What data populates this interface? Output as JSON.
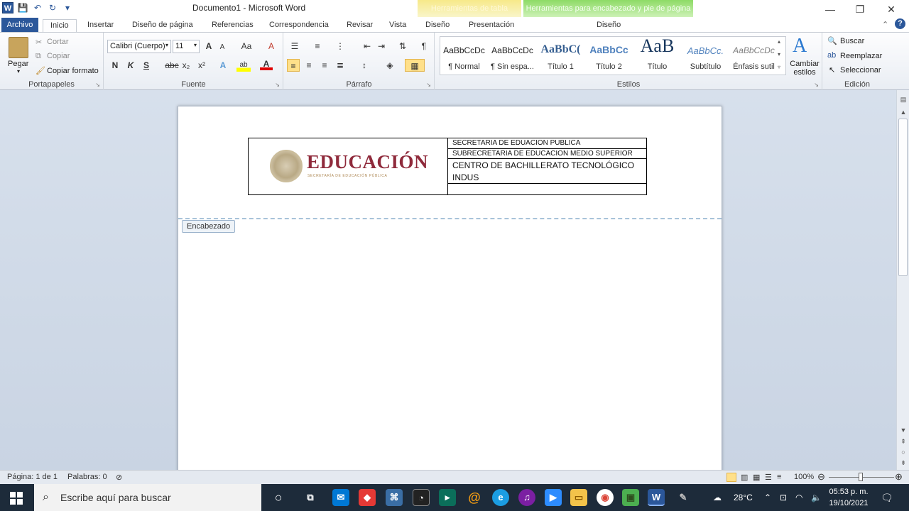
{
  "window": {
    "title": "Documento1  -  Microsoft Word",
    "minimize_glyph": "—",
    "restore_glyph": "❐",
    "close_glyph": "✕"
  },
  "qat": {
    "app_icon": "W",
    "save_glyph": "💾",
    "undo_glyph": "↶",
    "redo_glyph": "↻",
    "customize_glyph": "▾"
  },
  "context_tabs": {
    "table_tools": "Herramientas de tabla",
    "header_footer_tools": "Herramientas para encabezado y pie de página"
  },
  "tabs": {
    "file": "Archivo",
    "home": "Inicio",
    "insert": "Insertar",
    "page_layout": "Diseño de página",
    "references": "Referencias",
    "mailings": "Correspondencia",
    "review": "Revisar",
    "view": "Vista",
    "table_design": "Diseño",
    "table_layout": "Presentación",
    "header_design": "Diseño"
  },
  "clipboard": {
    "label": "Portapapeles",
    "paste": "Pegar",
    "cut": "Cortar",
    "copy": "Copiar",
    "format_painter": "Copiar formato"
  },
  "font": {
    "label": "Fuente",
    "name": "Calibri (Cuerpo)",
    "size": "11",
    "bold": "N",
    "italic": "K",
    "underline": "S",
    "strike": "abc",
    "subscript": "x₂",
    "superscript": "x²",
    "grow": "A",
    "shrink": "A",
    "case": "Aa",
    "clear": "A",
    "effects": "A",
    "highlight": "ab",
    "color": "A"
  },
  "paragraph": {
    "label": "Párrafo",
    "pilcrow": "¶"
  },
  "styles": {
    "label": "Estilos",
    "items": [
      {
        "sample": "AaBbCcDc",
        "name": "¶ Normal"
      },
      {
        "sample": "AaBbCcDc",
        "name": "¶ Sin espa..."
      },
      {
        "sample": "AaBbC(",
        "name": "Título 1"
      },
      {
        "sample": "AaBbCc",
        "name": "Título 2"
      },
      {
        "sample": "AaB",
        "name": "Título"
      },
      {
        "sample": "AaBbCc.",
        "name": "Subtítulo"
      },
      {
        "sample": "AaBbCcDc",
        "name": "Énfasis sutil"
      }
    ],
    "change": "Cambiar estilos"
  },
  "editing": {
    "label": "Edición",
    "find": "Buscar",
    "replace": "Reemplazar",
    "select": "Seleccionar"
  },
  "document": {
    "logo_word": "EDUCACIÓN",
    "logo_sub": "SECRETARÍA DE EDUCACIÓN PÚBLICA",
    "row1": "SECRETARIA DE EDUACION PUBLICA",
    "row2": "SUBRECRETARIA DE EDUCACION MEDIO SUPERIOR",
    "row3": "CENTRO DE BACHILLERATO TECNOLÓGICO INDUS",
    "row4": "",
    "header_tag": "Encabezado"
  },
  "statusbar": {
    "page": "Página: 1 de 1",
    "words": "Palabras: 0",
    "zoom": "100%",
    "zoom_minus": "⊖",
    "zoom_plus": "⊕"
  },
  "taskbar": {
    "search_placeholder": "Escribe aquí para buscar",
    "weather": "28°C",
    "time": "05:53 p. m.",
    "date": "19/10/2021"
  },
  "colors": {
    "brand": "#2b579a",
    "logo": "#8f2a3b",
    "taskbar": "#1d2b3a"
  }
}
